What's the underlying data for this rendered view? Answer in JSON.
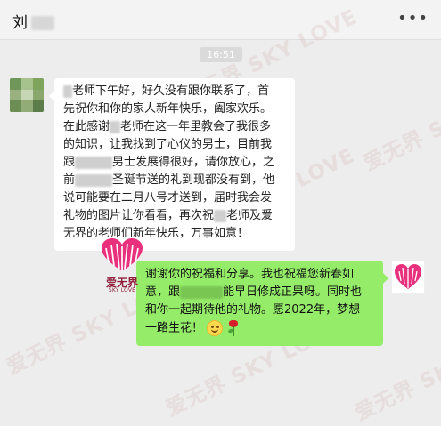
{
  "header": {
    "contact_name": "刘",
    "more_icon": "more-dots-icon"
  },
  "chat": {
    "timestamp": "16:51",
    "watermark_text": "爱无界 SKY LOVE",
    "left_message": {
      "lines": [
        [
          "",
          "老师下午好，好久没有跟你联系了，首"
        ],
        [
          "先祝你和你的家人新年快乐，阖家欢乐。"
        ],
        [
          "在此感谢",
          "老师在这一年里教会了我很多"
        ],
        [
          "的知识，让我找到了心仪的男士，目前我"
        ],
        [
          "跟",
          "男士发展得很好，请你放心，之"
        ],
        [
          "前",
          "圣诞节送的礼到现都没有到，他"
        ],
        [
          "说可能要在二月八号才送到，届时我会发"
        ],
        [
          "礼物的图片让你看看，再次祝",
          "老师及爱"
        ],
        [
          "无界的老师们新年快乐，万事如意！"
        ]
      ]
    },
    "brand": {
      "name": "爱无界",
      "subtitle": "SKY LOVE"
    },
    "right_message": {
      "lines": [
        [
          "谢谢你的祝福和分享。我也祝福您新春如"
        ],
        [
          "意，跟",
          "能早日修成正果呀。同时也"
        ],
        [
          "和你一起期待他的礼物。愿2022年，梦想"
        ],
        [
          "一路生花！"
        ]
      ],
      "emojis": [
        "smile-emoji",
        "rose-emoji"
      ]
    }
  },
  "colors": {
    "window_bg": "#ededed",
    "topbar_bg": "#f3f3f3",
    "incoming_bubble": "#ffffff",
    "outgoing_bubble": "#95ec69",
    "brand_pink": "#e9307d",
    "brand_dark": "#8f1f3a"
  }
}
